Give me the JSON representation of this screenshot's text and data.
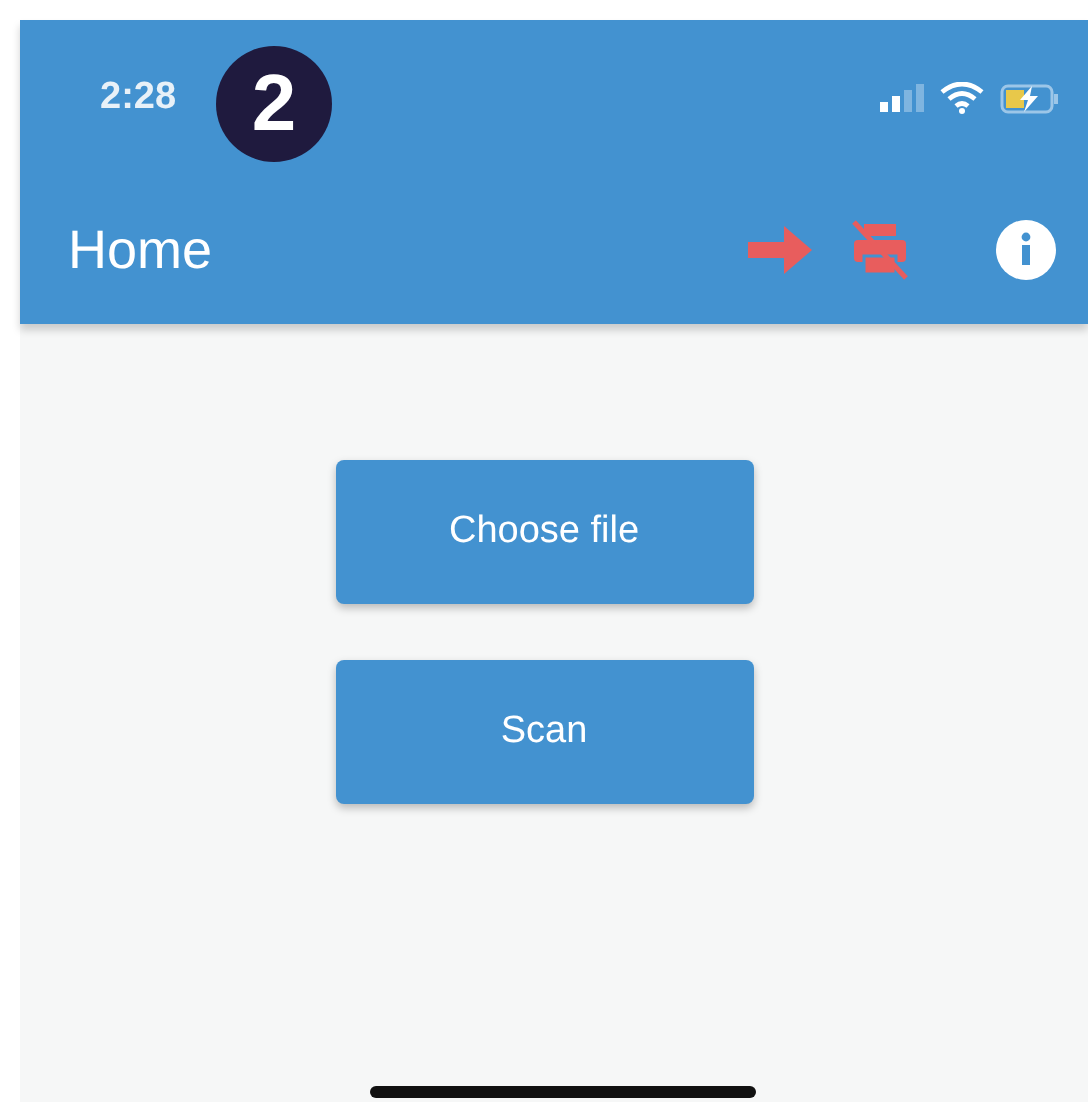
{
  "status_bar": {
    "time": "2:28"
  },
  "callout": {
    "number": "2"
  },
  "app_bar": {
    "title": "Home"
  },
  "buttons": [
    "Choose file",
    "Scan"
  ]
}
